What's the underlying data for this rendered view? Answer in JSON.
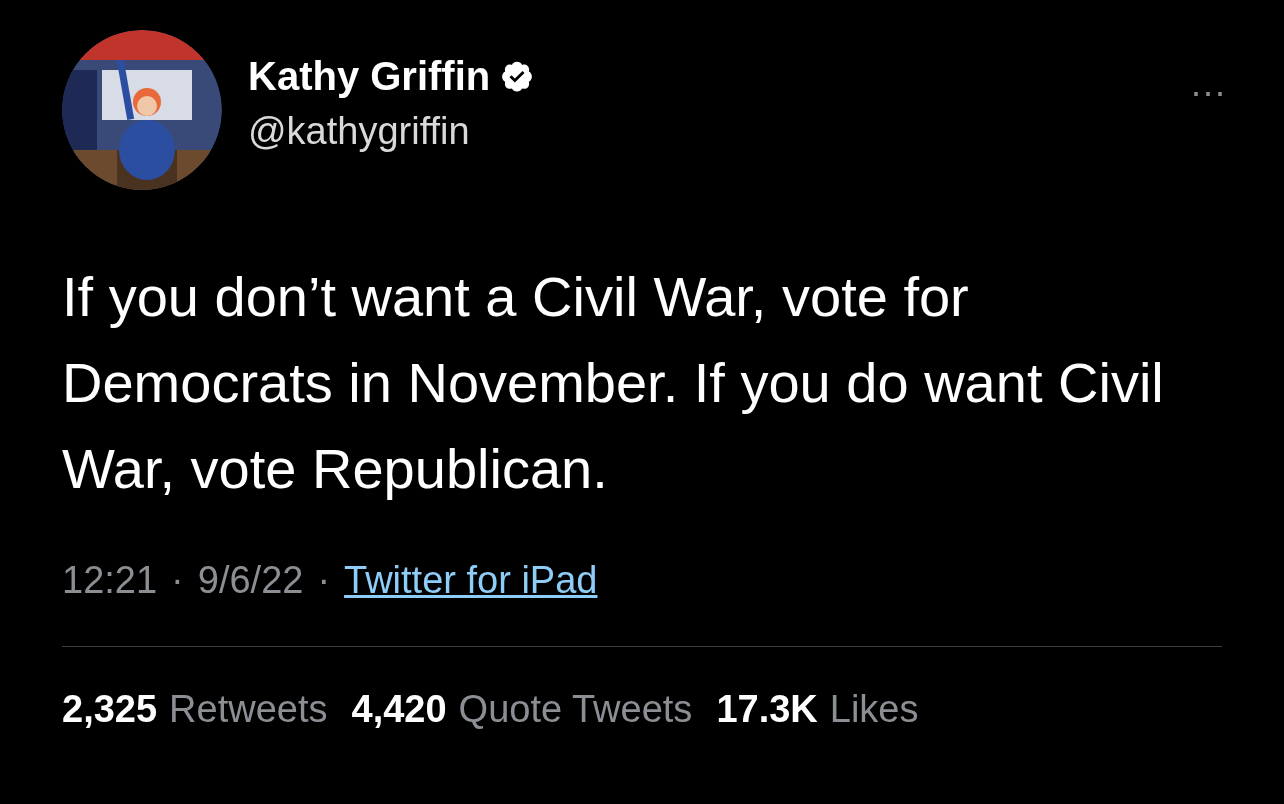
{
  "author": {
    "name": "Kathy Griffin",
    "verified": true,
    "handle": "@kathygriffin"
  },
  "more": "···",
  "tweet": {
    "text": "If you don’t want a Civil War, vote for Democrats in November. If you do want Civil War, vote Republican."
  },
  "meta": {
    "time": "12:21",
    "separator_1": "·",
    "date": "9/6/22",
    "separator_2": "·",
    "source": "Twitter for iPad"
  },
  "stats": [
    {
      "count": "2,325",
      "label": "Retweets"
    },
    {
      "count": "4,420",
      "label": "Quote Tweets"
    },
    {
      "count": "17.3K",
      "label": "Likes"
    }
  ]
}
